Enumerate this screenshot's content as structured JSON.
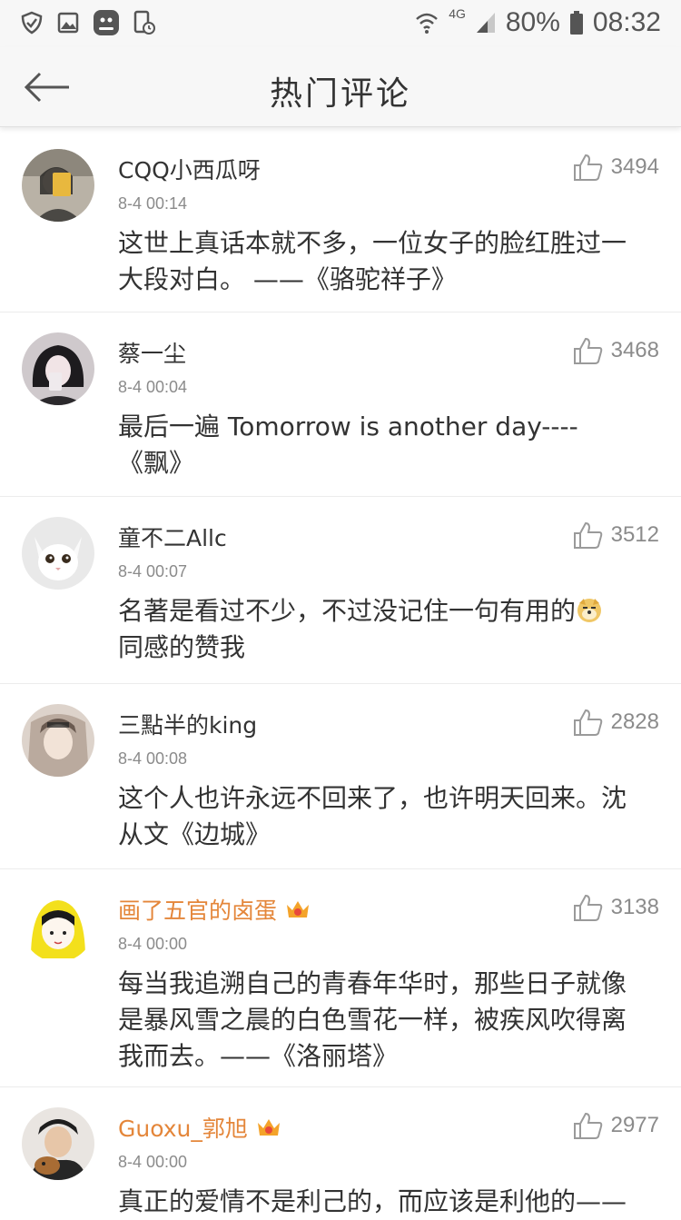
{
  "status_bar": {
    "icons_left": [
      "shield-check-icon",
      "image-icon",
      "app-badge-icon",
      "phone-clock-icon"
    ],
    "network": "4G",
    "battery": "80%",
    "time": "08:32"
  },
  "header": {
    "title": "热门评论",
    "back_icon": "back-arrow-icon"
  },
  "colors": {
    "vip_name": "#e4863a",
    "text": "#333333",
    "meta": "#8b8b8b"
  },
  "comments": [
    {
      "user": "CQQ小西瓜呀",
      "time": "8-4 00:14",
      "likes": "3494",
      "text": "这世上真话本就不多，一位女子的脸红胜过一\n大段对白。 ——《骆驼祥子》",
      "vip": false
    },
    {
      "user": "蔡一尘",
      "time": "8-4 00:04",
      "likes": "3468",
      "text": "最后一遍 Tomorrow is another day----\n《飘》",
      "vip": false
    },
    {
      "user": "童不二Allc",
      "time": "8-4 00:07",
      "likes": "3512",
      "text_a": "名著是看过不少，不过没记住一句有用的",
      "text_b": "同感的赞我",
      "vip": false
    },
    {
      "user": "三點半的king",
      "time": "8-4 00:08",
      "likes": "2828",
      "text": "这个人也许永远不回来了，也许明天回来。沈\n从文《边城》",
      "vip": false
    },
    {
      "user": "画了五官的卤蛋",
      "time": "8-4 00:00",
      "likes": "3138",
      "text": "每当我追溯自己的青春年华时，那些日子就像\n是暴风雪之晨的白色雪花一样，被疾风吹得离\n我而去。——《洛丽塔》",
      "vip": true
    },
    {
      "user": "Guoxu_郭旭",
      "time": "8-4 00:00",
      "likes": "2977",
      "text": "真正的爱情不是利己的，而应该是利他的——",
      "vip": true
    }
  ]
}
